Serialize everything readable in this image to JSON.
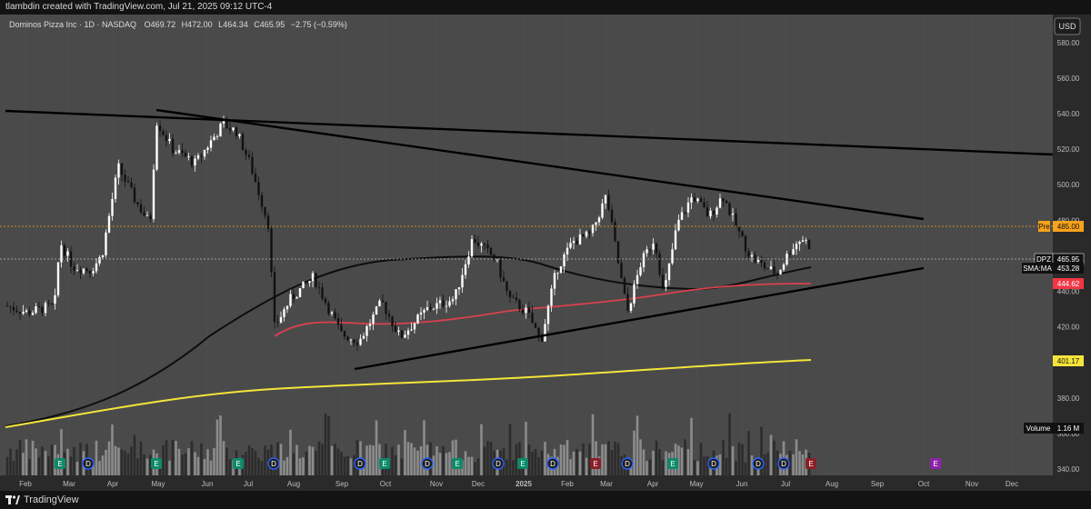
{
  "header": {
    "attribution": "tlambdin created with TradingView.com, Jul 21, 2025 09:12 UTC-4"
  },
  "legend": {
    "symbol_name": "Dominos Pizza Inc · 1D · NASDAQ",
    "open_label": "O",
    "open": "469.72",
    "high_label": "H",
    "high": "472.00",
    "low_label": "L",
    "low": "464.34",
    "close_label": "C",
    "close": "465.95",
    "change": "−2.75 (−0.59%)"
  },
  "currency_button": "USD",
  "price_axis": {
    "ticks": [
      "580.00",
      "560.00",
      "540.00",
      "520.00",
      "500.00",
      "480.00",
      "460.00",
      "440.00",
      "420.00",
      "400.00",
      "380.00",
      "360.00",
      "340.00"
    ],
    "tags": {
      "pre_label": "Pre",
      "pre_value": "485.00",
      "dpz_label": "DPZ",
      "dpz_value": "465.95",
      "sma_label": "SMA:MA",
      "sma_value": "453.28",
      "ma_red_value": "444.62",
      "ma_yellow_value": "401.17",
      "volume_label": "Volume",
      "volume_value": "1.16 M"
    }
  },
  "time_axis": {
    "labels": [
      "Feb",
      "Mar",
      "Apr",
      "May",
      "Jun",
      "Jul",
      "Aug",
      "Sep",
      "Oct",
      "Nov",
      "Dec",
      "2025",
      "Feb",
      "Mar",
      "Apr",
      "May",
      "Jun",
      "Jul",
      "Aug",
      "Sep",
      "Oct",
      "Nov",
      "Dec"
    ]
  },
  "events": [
    "E",
    "D",
    "E",
    "E",
    "D",
    "D",
    "E",
    "D",
    "E",
    "D",
    "E",
    "D",
    "E",
    "E",
    "E"
  ],
  "colors": {
    "chart_bg": "#4a4a4a",
    "candle_up": "#ffffff",
    "candle_down": "#111111",
    "trendline": "#000000",
    "ma_black": "#0d0d0d",
    "ma_red": "#d9414e",
    "ma_yellow": "#f5e53a",
    "pre_tag": "#f7a21b",
    "red_tag": "#f23645",
    "event_earnings": "#f23645",
    "event_dividend": "#2962ff"
  },
  "footer": {
    "brand": "TradingView"
  }
}
